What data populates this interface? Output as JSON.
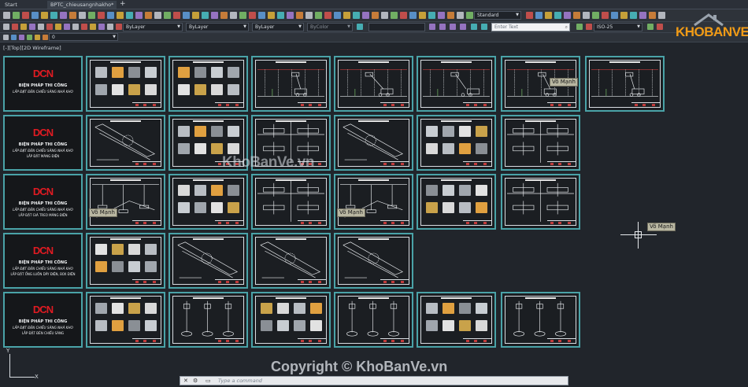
{
  "tabs": [
    {
      "label": "Start",
      "active": false
    },
    {
      "label": "BPTC_chieusangnhakho*",
      "active": true
    }
  ],
  "toolbar": {
    "text_style": "Standard",
    "layer_color": "ByLayer",
    "linetype": "ByLayer",
    "lineweight": "ByLayer",
    "plot_style": "ByColor",
    "layer_value": "0",
    "search_placeholder": "Enter Text",
    "dim_style": "ISO-25"
  },
  "viewport": {
    "label": "[-][Top][2D Wireframe]"
  },
  "brand": {
    "name": "KHOBANVE"
  },
  "covers": [
    {
      "title": "BIỆN PHÁP THI CÔNG",
      "subtitle": "LẮP ĐẶT ĐÈN CHIẾU SÁNG NHÀ KHO",
      "section": ""
    },
    {
      "title": "BIỆN PHÁP THI CÔNG",
      "subtitle": "LẮP ĐẶT ĐÈN CHIẾU SÁNG NHÀ KHO",
      "section": "LẮP ĐẶT MÁNG ĐIỆN"
    },
    {
      "title": "BIỆN PHÁP THI CÔNG",
      "subtitle": "LẮP ĐẶT ĐÈN CHIẾU SÁNG NHÀ KHO",
      "section": "LẮP ĐẶT GIÁ TREO MÁNG ĐIỆN"
    },
    {
      "title": "BIỆN PHÁP THI CÔNG",
      "subtitle": "LẮP ĐẶT ĐÈN CHIẾU SÁNG NHÀ KHO",
      "section": "LẮP ĐẶT ỐNG LUỒN DÂY ĐIỆN, BOX ĐIỆN"
    },
    {
      "title": "BIỆN PHÁP THI CÔNG",
      "subtitle": "LẮP ĐẶT ĐÈN CHIẾU SÁNG NHÀ KHO",
      "section": "LẮP ĐẶT ĐÈN CHIẾU SÁNG"
    }
  ],
  "logo_text": "DCN",
  "tags": [
    "Võ Mạnh",
    "Võ Mạnh",
    "Võ Mạnh",
    "Võ Mạnh"
  ],
  "watermark": "KhoBanVe.vn",
  "copyright": "Copyright © KhoBanVe.vn",
  "command": {
    "prompt": "Type a command"
  },
  "ucs": {
    "x": "X",
    "y": "Y"
  }
}
